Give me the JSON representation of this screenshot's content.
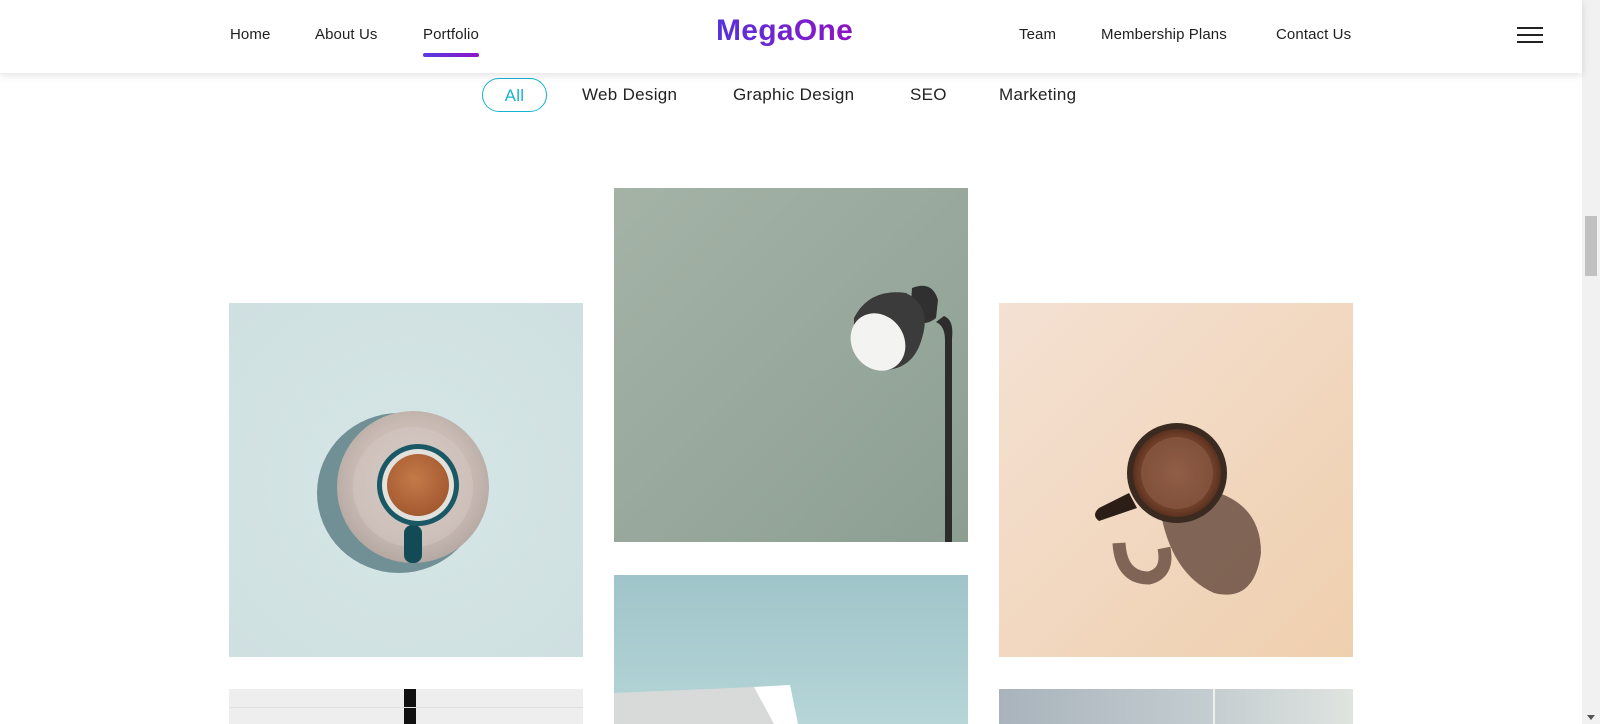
{
  "header": {
    "logo": "MegaOne",
    "nav_left": [
      {
        "label": "Home"
      },
      {
        "label": "About Us"
      },
      {
        "label": "Portfolio",
        "active": true
      }
    ],
    "nav_right": [
      {
        "label": "Team"
      },
      {
        "label": "Membership Plans"
      },
      {
        "label": "Contact Us"
      }
    ],
    "menu_icon": "hamburger-menu-icon"
  },
  "filters": {
    "items": [
      {
        "label": "All",
        "active": true
      },
      {
        "label": "Web Design"
      },
      {
        "label": "Graphic Design"
      },
      {
        "label": "SEO"
      },
      {
        "label": "Marketing"
      }
    ],
    "active_color": "#17b3cf"
  },
  "portfolio": {
    "items": [
      {
        "subject": "coffee-cup-on-saucer",
        "background": "#d3e3e3"
      },
      {
        "subject": "floor-lamp",
        "background": "#9aab9f"
      },
      {
        "subject": "coffee-mug-shadow",
        "background": "#f2dac6"
      },
      {
        "subject": "white-interior",
        "background": "#efefef"
      },
      {
        "subject": "building-sky",
        "background": "#a4c9cd"
      },
      {
        "subject": "gray-gradient",
        "background": "#b6bfc6"
      }
    ]
  },
  "colors": {
    "brand_gradient_start": "#5633dc",
    "brand_gradient_end": "#8f12c4"
  }
}
